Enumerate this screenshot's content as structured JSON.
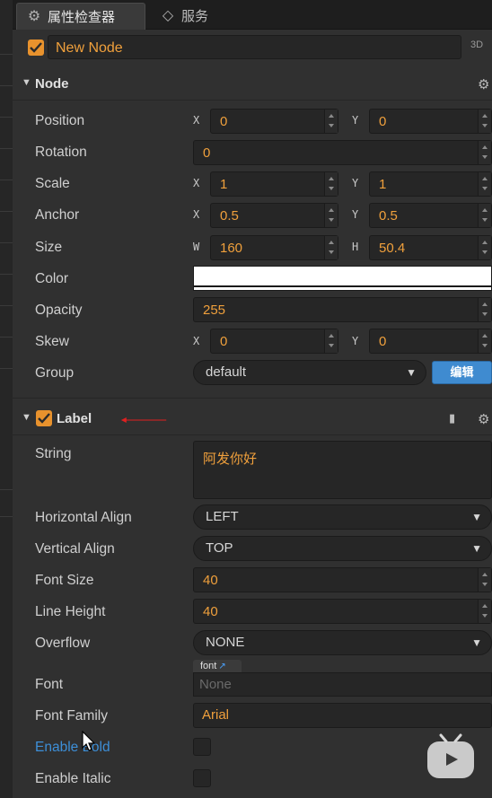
{
  "tabs": [
    {
      "label": "属性检查器",
      "icon": "gear-icon"
    },
    {
      "label": "服务",
      "icon": "diamond-link-icon"
    }
  ],
  "node": {
    "enabled": true,
    "name": "New Node",
    "mode_3d": "3D"
  },
  "sections": {
    "node": "Node",
    "label": "Label"
  },
  "node_props": {
    "position": {
      "label": "Position",
      "x_axis": "X",
      "x": "0",
      "y_axis": "Y",
      "y": "0"
    },
    "rotation": {
      "label": "Rotation",
      "value": "0"
    },
    "scale": {
      "label": "Scale",
      "x_axis": "X",
      "x": "1",
      "y_axis": "Y",
      "y": "1"
    },
    "anchor": {
      "label": "Anchor",
      "x_axis": "X",
      "x": "0.5",
      "y_axis": "Y",
      "y": "0.5"
    },
    "size": {
      "label": "Size",
      "w_axis": "W",
      "w": "160",
      "h_axis": "H",
      "h": "50.4"
    },
    "color": {
      "label": "Color",
      "value": "#ffffff"
    },
    "opacity": {
      "label": "Opacity",
      "value": "255"
    },
    "skew": {
      "label": "Skew",
      "x_axis": "X",
      "x": "0",
      "y_axis": "Y",
      "y": "0"
    },
    "group": {
      "label": "Group",
      "value": "default",
      "edit_label": "编辑"
    }
  },
  "label_props": {
    "string": {
      "label": "String",
      "value": "阿发你好"
    },
    "horizontal_align": {
      "label": "Horizontal Align",
      "value": "LEFT"
    },
    "vertical_align": {
      "label": "Vertical Align",
      "value": "TOP"
    },
    "font_size": {
      "label": "Font Size",
      "value": "40"
    },
    "line_height": {
      "label": "Line Height",
      "value": "40"
    },
    "overflow": {
      "label": "Overflow",
      "value": "NONE"
    },
    "font": {
      "label": "Font",
      "tag": "font",
      "value": "None"
    },
    "font_family": {
      "label": "Font Family",
      "value": "Arial"
    },
    "enable_bold": {
      "label": "Enable Bold",
      "checked": false
    },
    "enable_italic": {
      "label": "Enable Italic",
      "checked": false
    }
  },
  "colors": {
    "accent": "#e8922d",
    "value_text": "#f0a03c",
    "button_blue": "#3f8bd0",
    "annotation_red": "#e02020"
  }
}
